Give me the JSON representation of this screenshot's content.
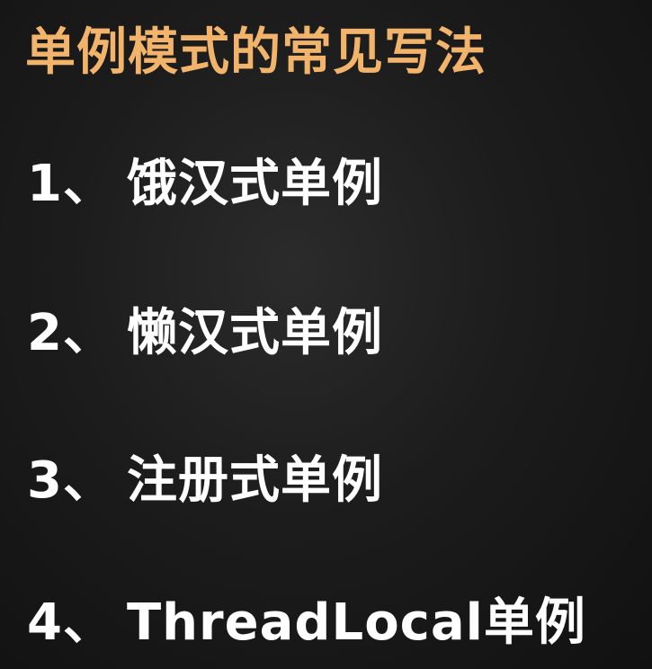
{
  "colors": {
    "title": "#f2b46a",
    "text": "#ffffff",
    "background": "#1c1c1c"
  },
  "title": "单例模式的常见写法",
  "items": [
    {
      "number": "1",
      "separator": "、",
      "label": "饿汉式单例"
    },
    {
      "number": "2",
      "separator": "、",
      "label": "懒汉式单例"
    },
    {
      "number": "3",
      "separator": "、",
      "label": "注册式单例"
    },
    {
      "number": "4",
      "separator": "、",
      "label": "ThreadLocal单例"
    }
  ]
}
